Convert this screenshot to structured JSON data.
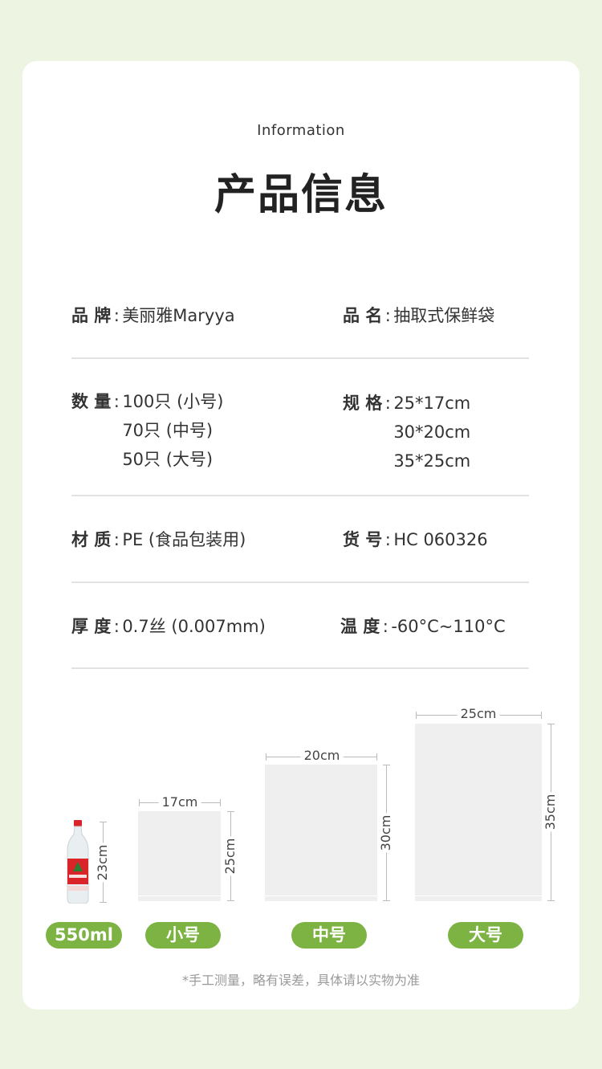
{
  "header": {
    "eyebrow": "Information",
    "title": "产品信息"
  },
  "specs": {
    "brand": {
      "label": "品 牌",
      "colon": ":",
      "values": [
        "美丽雅Maryya"
      ]
    },
    "name": {
      "label": "品 名",
      "colon": ":",
      "values": [
        "抽取式保鲜袋"
      ]
    },
    "quantity": {
      "label": "数 量",
      "colon": ":",
      "values": [
        "100只 (小号)",
        "70只 (中号)",
        "50只 (大号)"
      ]
    },
    "size": {
      "label": "规 格",
      "colon": ":",
      "values": [
        "25*17cm",
        "30*20cm",
        "35*25cm"
      ]
    },
    "material": {
      "label": "材 质",
      "colon": ":",
      "values": [
        "PE (食品包装用)"
      ]
    },
    "item_no": {
      "label": "货 号",
      "colon": ":",
      "values": [
        "HC 060326"
      ]
    },
    "thickness": {
      "label": "厚 度",
      "colon": ":",
      "values": [
        "0.7丝 (0.007mm)"
      ]
    },
    "temperature": {
      "label": "温 度",
      "colon": ":",
      "values": [
        "-60°C~110°C"
      ]
    }
  },
  "comparison": {
    "bottle": {
      "height": "23cm",
      "tag": "550ml"
    },
    "small": {
      "width": "17cm",
      "height": "25cm",
      "tag": "小号"
    },
    "medium": {
      "width": "20cm",
      "height": "30cm",
      "tag": "中号"
    },
    "large": {
      "width": "25cm",
      "height": "35cm",
      "tag": "大号"
    }
  },
  "note": "*手工测量，略有误差，具体请以实物为准",
  "colors": {
    "accent": "#7cb342",
    "page_bg": "#edf5e2",
    "card_bg": "#ffffff",
    "bag": "#efefef"
  }
}
